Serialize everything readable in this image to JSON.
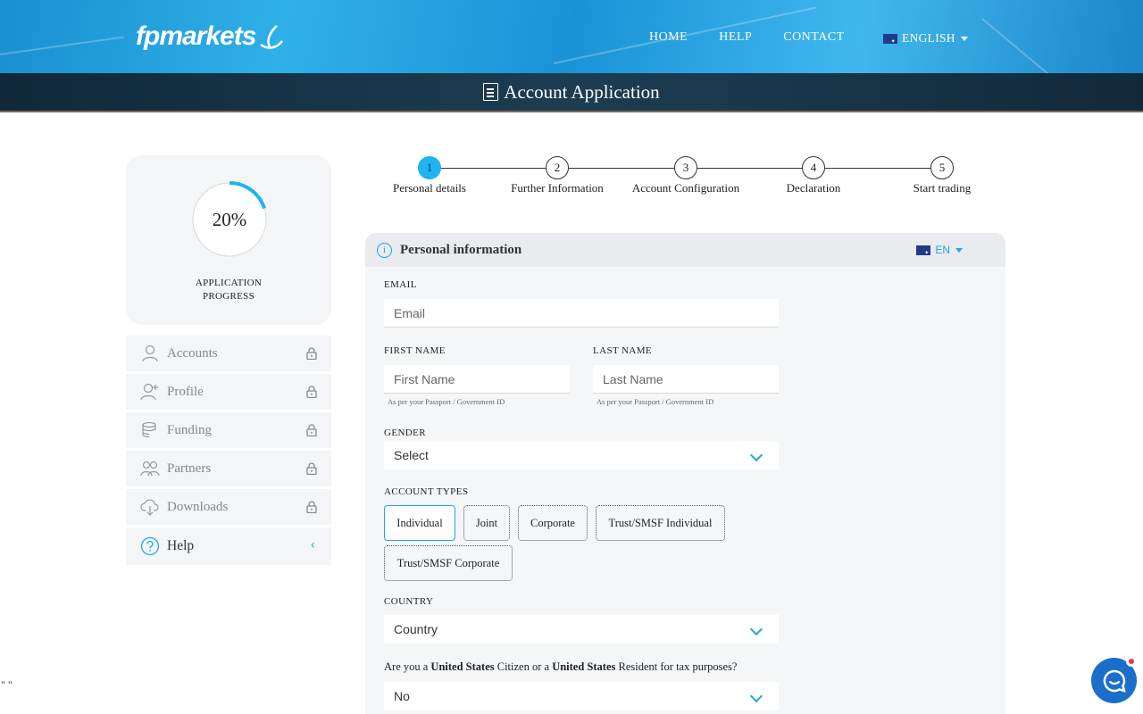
{
  "header": {
    "logo": "fpmarkets",
    "nav": [
      "HOME",
      "HELP",
      "CONTACT"
    ],
    "language": "ENGLISH",
    "page_title": "Account Application"
  },
  "sidebar": {
    "progress": {
      "percent_text": "20%",
      "value": 0.2,
      "label_line1": "APPLICATION",
      "label_line2": "PROGRESS"
    },
    "items": [
      {
        "label": "Accounts",
        "icon": "user-icon",
        "locked": true
      },
      {
        "label": "Profile",
        "icon": "user-plus-icon",
        "locked": true
      },
      {
        "label": "Funding",
        "icon": "coins-icon",
        "locked": true
      },
      {
        "label": "Partners",
        "icon": "users-icon",
        "locked": true
      },
      {
        "label": "Downloads",
        "icon": "cloud-download-icon",
        "locked": true
      }
    ],
    "help": {
      "label": "Help",
      "icon": "question-circle-icon"
    }
  },
  "stepper": {
    "steps": [
      {
        "number": "1",
        "label": "Personal details",
        "active": true
      },
      {
        "number": "2",
        "label": "Further Information",
        "active": false
      },
      {
        "number": "3",
        "label": "Account Configuration",
        "active": false
      },
      {
        "number": "4",
        "label": "Declaration",
        "active": false
      },
      {
        "number": "5",
        "label": "Start trading",
        "active": false
      }
    ]
  },
  "form": {
    "section_title": "Personal information",
    "lang_code": "EN",
    "email": {
      "label": "EMAIL",
      "placeholder": "Email"
    },
    "first_name": {
      "label": "FIRST NAME",
      "placeholder": "First Name",
      "hint": "As per your Passport / Government ID"
    },
    "last_name": {
      "label": "LAST NAME",
      "placeholder": "Last Name",
      "hint": "As per your Passport / Government ID"
    },
    "gender": {
      "label": "GENDER",
      "value": "Select"
    },
    "account_types": {
      "label": "ACCOUNT TYPES",
      "options": [
        "Individual",
        "Joint",
        "Corporate",
        "Trust/SMSF Individual",
        "Trust/SMSF Corporate"
      ],
      "selected": "Individual"
    },
    "country": {
      "label": "COUNTRY",
      "value": "Country"
    },
    "us_tax": {
      "q_part1": "Are you a ",
      "q_bold1": "United States",
      "q_part2": " Citizen or a ",
      "q_bold2": "United States",
      "q_part3": " Resident for tax purposes?",
      "value": "No"
    }
  },
  "misc": {
    "stray_text": "\" \""
  },
  "colors": {
    "accent": "#1fa8e0",
    "step_active": "#1fb3f0",
    "help_chevron": "#2db47a",
    "chat": "#1b6fc9"
  }
}
